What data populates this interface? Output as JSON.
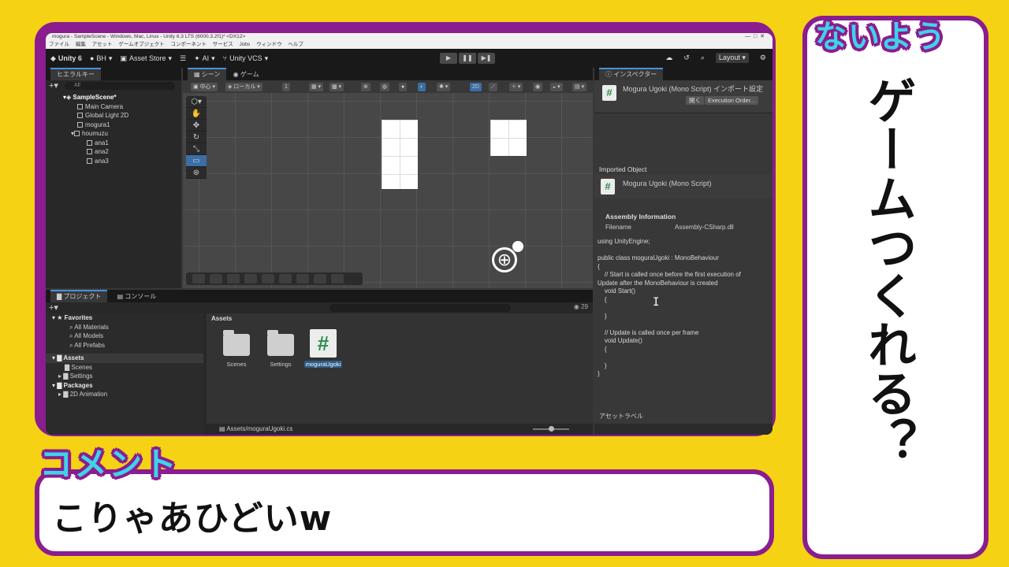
{
  "overlay": {
    "topic_title": "ないよう",
    "topic_text": "ゲームつくれる？",
    "comment_title": "コメント",
    "comment_text": "こりゃあひどいw"
  },
  "window": {
    "title": "mogura - SampleScene - Windows, Mac, Linux - Unity 6.3 LTS (6000.3.2f1)* <DX12>",
    "menu": [
      "ファイル",
      "編集",
      "アセット",
      "ゲームオブジェクト",
      "コンポーネント",
      "サービス",
      "Jobs",
      "ウィンドウ",
      "ヘルプ"
    ]
  },
  "toolbar": {
    "logo": "Unity 6",
    "account": "BH",
    "asset_store": "Asset Store",
    "ai": "AI",
    "vcs": "Unity VCS",
    "layout": "Layout"
  },
  "hierarchy": {
    "tab": "ヒエラルキー",
    "search_placeholder": "All",
    "items": [
      "SampleScene*",
      "Main Camera",
      "Global Light 2D",
      "mogura1",
      "houmuzu",
      "ana1",
      "ana2",
      "ana3"
    ]
  },
  "scene": {
    "tab_scene": "シーン",
    "tab_game": "ゲーム",
    "pivot": "中心",
    "space": "ローカル",
    "grid_value": "1",
    "mode_2d": "2D"
  },
  "inspector": {
    "tab": "インスペクター",
    "title": "Mogura Ugoki (Mono Script) インポート設定",
    "open_button": "開く",
    "exec_order_button": "Execution Order...",
    "imported_object_label": "Imported Object",
    "imported_title": "Mogura Ugoki (Mono Script)",
    "assembly_info_label": "Assembly Information",
    "filename_label": "Filename",
    "filename_value": "Assembly-CSharp.dll",
    "code": "using UnityEngine;\n\npublic class moguraUgoki : MonoBehaviour\n{\n    // Start is called once before the first execution of\nUpdate after the MonoBehaviour is created\n    void Start()\n    {\n\n    }\n\n    // Update is called once per frame\n    void Update()\n    {\n\n    }\n}",
    "asset_label": "アセットラベル"
  },
  "project": {
    "tab_project": "プロジェクト",
    "tab_console": "コンソール",
    "favorites_label": "Favorites",
    "favorites": [
      "All Materials",
      "All Models",
      "All Prefabs"
    ],
    "assets_label": "Assets",
    "asset_children": [
      "Scenes",
      "Settings"
    ],
    "packages_label": "Packages",
    "package_children": [
      "2D Animation"
    ],
    "breadcrumb": "Assets",
    "count": "29",
    "files": [
      "Scenes",
      "Settings",
      "moguraUgoki"
    ],
    "path": "Assets/moguraUgoki.cs"
  },
  "colors": {
    "background": "#f6d214",
    "frame": "#8a1d8f",
    "title_fill": "#3fd3e8"
  }
}
